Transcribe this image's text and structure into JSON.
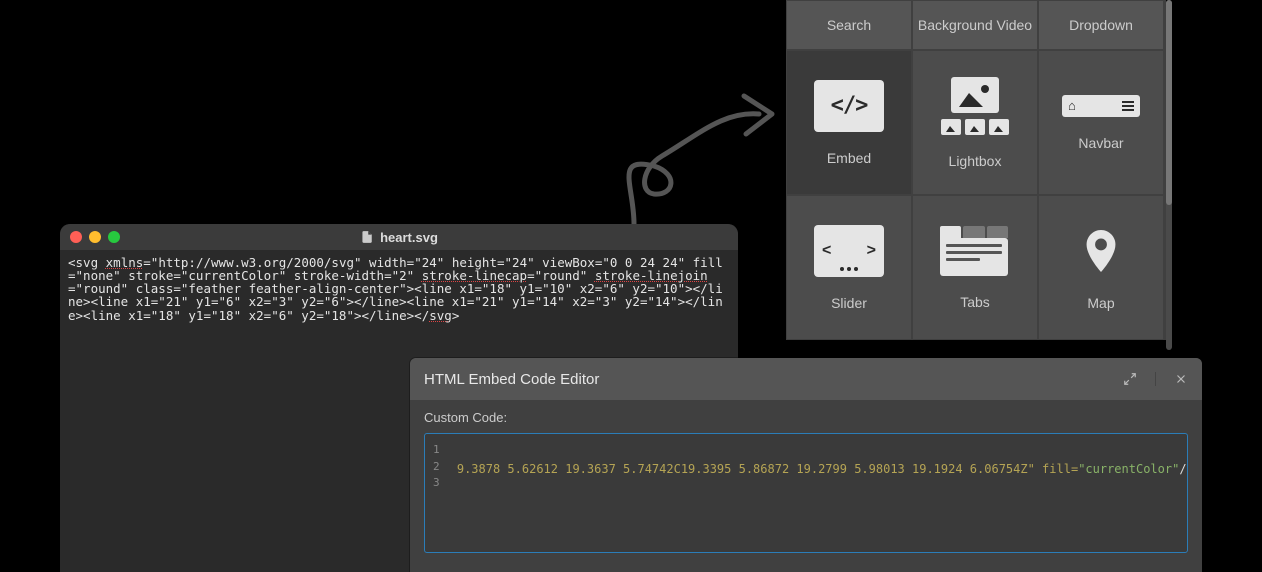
{
  "panel": {
    "header": [
      "Search",
      "Background Video",
      "Dropdown"
    ],
    "items": [
      "Embed",
      "Lightbox",
      "Navbar",
      "Slider",
      "Tabs",
      "Map"
    ]
  },
  "editor": {
    "filename": "heart.svg",
    "content_plain_1": "<svg ",
    "content_underlined_1": "xmlns",
    "content_plain_2": "=\"http://www.w3.org/2000/svg\" width=\"24\" height=\"24\" viewBox=\"0 0 24 24\" fill=\"none\" stroke=\"currentColor\" stroke-width=\"2\" ",
    "content_underlined_2": "stroke-linecap",
    "content_plain_3": "=\"round\" ",
    "content_underlined_3": "stroke-linejoin",
    "content_plain_4": "=\"round\" class=\"feather feather-align-center\"><line x1=\"18\" y1=\"10\" x2=\"6\" y2=\"10\"></line><line x1=\"21\" y1=\"6\" x2=\"3\" y2=\"6\"></line><line x1=\"21\" y1=\"14\" x2=\"3\" y2=\"14\"></line><line x1=\"18\" y1=\"18\" x2=\"6\" y2=\"18\"></line></",
    "content_underlined_4": "svg",
    "content_plain_5": ">"
  },
  "embedEditor": {
    "title": "HTML Embed Code Editor",
    "label": "Custom Code:",
    "line1": "1",
    "line2": "2",
    "line3": "3",
    "code_numbers": " 9.3878 5.62612 19.3637 5.74742C19.3395 5.86872 19.2799 5.98013 19.1924 6.06754Z\"",
    "code_attr": " fill=",
    "code_str": "\"currentColor\"",
    "code_end": "/>"
  }
}
